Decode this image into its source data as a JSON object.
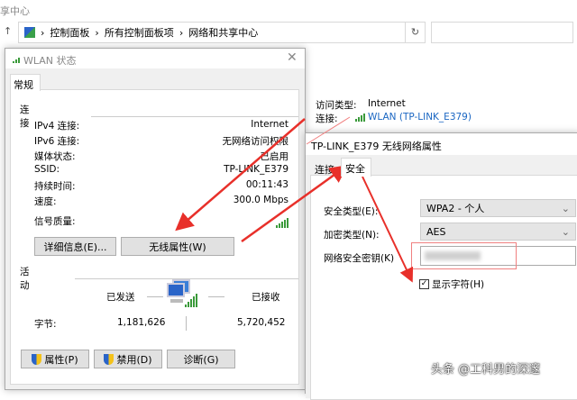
{
  "explorer": {
    "title_fragment": "享中心",
    "breadcrumb": [
      "控制面板",
      "所有控制面板项",
      "网络和共享中心"
    ],
    "refresh": "↻",
    "back": "↑",
    "access_label": "访问类型:",
    "access_value": "Internet",
    "conn_label": "连接:",
    "conn_value": "WLAN (TP-LINK_E379)"
  },
  "status": {
    "title": "WLAN 状态",
    "tab": "常规",
    "section_conn": "连接",
    "rows": [
      {
        "label": "IPv4 连接:",
        "value": "Internet"
      },
      {
        "label": "IPv6 连接:",
        "value": "无网络访问权限"
      },
      {
        "label": "媒体状态:",
        "value": "已启用"
      },
      {
        "label": "SSID:",
        "value": "TP-LINK_E379"
      },
      {
        "label": "持续时间:",
        "value": "00:11:43"
      },
      {
        "label": "速度:",
        "value": "300.0 Mbps"
      }
    ],
    "signal_label": "信号质量:",
    "details_btn": "详细信息(E)...",
    "wireless_btn": "无线属性(W)",
    "section_activity": "活动",
    "sent_label": "已发送",
    "recv_label": "已接收",
    "bytes_label": "字节:",
    "bytes_sent": "1,181,626",
    "bytes_recv": "5,720,452",
    "props_btn": "属性(P)",
    "disable_btn": "禁用(D)",
    "diagnose_btn": "诊断(G)"
  },
  "props": {
    "title": "TP-LINK_E379 无线网络属性",
    "tabs": [
      "连接",
      "安全"
    ],
    "sec_type_label": "安全类型(E):",
    "sec_type_value": "WPA2 - 个人",
    "enc_type_label": "加密类型(N):",
    "enc_type_value": "AES",
    "key_label": "网络安全密钥(K)",
    "show_chars": "显示字符(H)"
  },
  "watermark": "头条 @工科男的深邃",
  "colors": {
    "arrow": "#e8302a",
    "link": "#1a66c2"
  }
}
